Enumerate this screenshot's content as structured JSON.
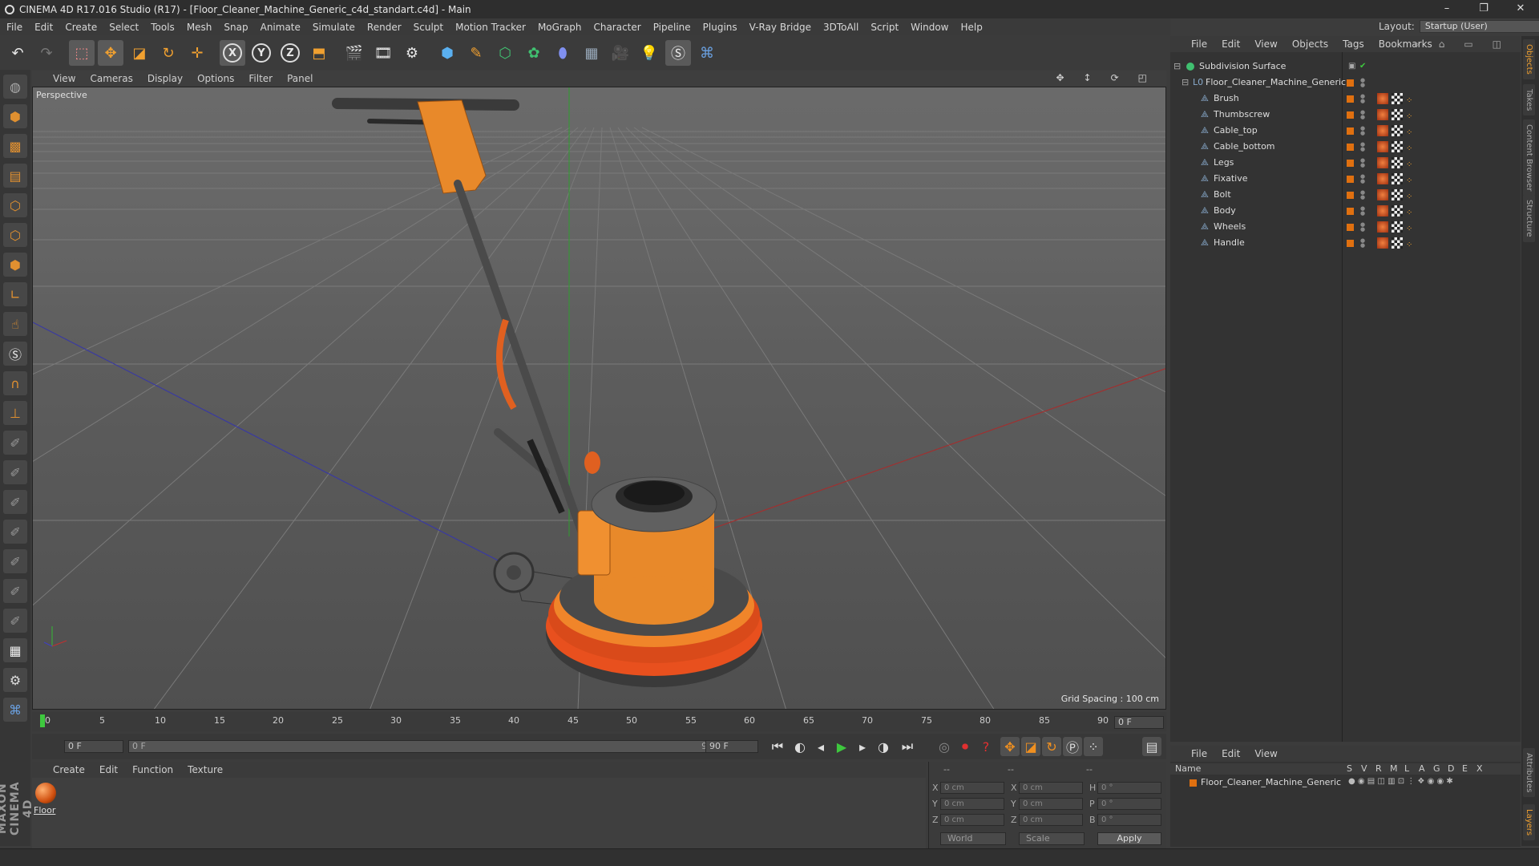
{
  "window": {
    "title": "CINEMA 4D R17.016 Studio (R17) - [Floor_Cleaner_Machine_Generic_c4d_standart.c4d] - Main",
    "minimize": "–",
    "restore": "❐",
    "close": "✕"
  },
  "menu": [
    "File",
    "Edit",
    "Create",
    "Select",
    "Tools",
    "Mesh",
    "Snap",
    "Animate",
    "Simulate",
    "Render",
    "Sculpt",
    "Motion Tracker",
    "MoGraph",
    "Character",
    "Pipeline",
    "Plugins",
    "V-Ray Bridge",
    "3DToAll",
    "Script",
    "Window",
    "Help"
  ],
  "layout": {
    "label": "Layout:",
    "value": "Startup (User)"
  },
  "viewport": {
    "menu": [
      "View",
      "Cameras",
      "Display",
      "Options",
      "Filter",
      "Panel"
    ],
    "camera_label": "Perspective",
    "grid_spacing": "Grid Spacing : 100 cm"
  },
  "timeline": {
    "ticks": [
      "0",
      "5",
      "10",
      "15",
      "20",
      "25",
      "30",
      "35",
      "40",
      "45",
      "50",
      "55",
      "60",
      "65",
      "70",
      "75",
      "80",
      "85",
      "90"
    ],
    "current_frame": "0 F",
    "start_field": "0 F",
    "range_start": "0 F",
    "range_end": "90 F",
    "end_field": "90 F"
  },
  "material_manager": {
    "menu": [
      "Create",
      "Edit",
      "Function",
      "Texture"
    ],
    "material_name": "Floor"
  },
  "coordinates": {
    "header": [
      "--",
      "--",
      "--"
    ],
    "rows": [
      {
        "a": "X",
        "av": "0 cm",
        "b": "X",
        "bv": "0 cm",
        "c": "H",
        "cv": "0 °"
      },
      {
        "a": "Y",
        "av": "0 cm",
        "b": "Y",
        "bv": "0 cm",
        "c": "P",
        "cv": "0 °"
      },
      {
        "a": "Z",
        "av": "0 cm",
        "b": "Z",
        "bv": "0 cm",
        "c": "B",
        "cv": "0 °"
      }
    ],
    "space": "World",
    "mode": "Scale",
    "apply": "Apply"
  },
  "object_manager": {
    "menu": [
      "File",
      "Edit",
      "View",
      "Objects",
      "Tags",
      "Bookmarks"
    ],
    "objects": [
      {
        "name": "Subdivision Surface",
        "level": 0
      },
      {
        "name": "Floor_Cleaner_Machine_Generic",
        "level": 1
      },
      {
        "name": "Brush",
        "level": 2
      },
      {
        "name": "Thumbscrew",
        "level": 2
      },
      {
        "name": "Cable_top",
        "level": 2
      },
      {
        "name": "Cable_bottom",
        "level": 2
      },
      {
        "name": "Legs",
        "level": 2
      },
      {
        "name": "Fixative",
        "level": 2
      },
      {
        "name": "Bolt",
        "level": 2
      },
      {
        "name": "Body",
        "level": 2
      },
      {
        "name": "Wheels",
        "level": 2
      },
      {
        "name": "Handle",
        "level": 2
      }
    ]
  },
  "layer_manager": {
    "menu": [
      "File",
      "Edit",
      "View"
    ],
    "columns": [
      "Name",
      "S",
      "V",
      "R",
      "M",
      "L",
      "A",
      "G",
      "D",
      "E",
      "X"
    ],
    "layer": "Floor_Cleaner_Machine_Generic"
  },
  "right_tabs": [
    "Objects",
    "Takes",
    "Content Browser",
    "Structure",
    "Attributes",
    "Layers"
  ],
  "brand": "MAXON CINEMA 4D",
  "colors": {
    "accent": "#e07010",
    "object": "#e8892a",
    "playhead": "#3ec83e"
  }
}
